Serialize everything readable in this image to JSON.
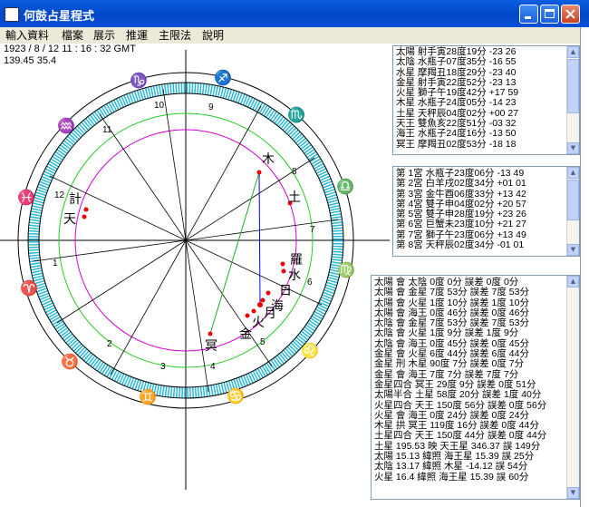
{
  "window": {
    "title": "何鼓占星程式"
  },
  "menu": [
    "輸入資料",
    "檔案",
    "展示",
    "推運",
    "主限法",
    "說明"
  ],
  "info": {
    "datetime": "1923 / 8 / 12    11 : 16 : 32 GMT",
    "coords": "139.45   35.4"
  },
  "chart": {
    "signs": [
      "♑",
      "♒",
      "♓",
      "♈",
      "♉",
      "♊",
      "♋",
      "♌",
      "♍",
      "♎",
      "♏",
      "♐"
    ],
    "houses": [
      "1",
      "2",
      "3",
      "4",
      "5",
      "6",
      "7",
      "8",
      "9",
      "10",
      "11",
      "12"
    ],
    "planets": {
      "moon": "月",
      "sun": "日",
      "mercury": "水",
      "venus": "金",
      "mars": "火",
      "jupiter": "木",
      "saturn": "土",
      "uranus": "天",
      "neptune": "海",
      "pluto": "冥",
      "node": "羅",
      "south_node": "計"
    }
  },
  "planet_panel": [
    "太陽  射手寅28度19分   -23 26",
    "太陰  水瓶子07度35分   -16 55",
    "水星  摩羯丑18度29分   -23 40",
    "金星  射手寅22度52分   -23 13",
    "火星  獅子午19度42分   +17 59",
    "木星  水瓶子24度05分   -14 23",
    "土星  天秤辰04度02分   +00 27",
    "天王  雙魚亥22度51分   -03 32",
    "海王  水瓶子24度16分   -13 50",
    "冥王  摩羯丑02度53分   -18 18"
  ],
  "house_panel": [
    "第 1宮  水瓶子23度06分  -13 49",
    "第 2宮  白羊戌02度34分  +01 01",
    "第 3宮  金牛酉06度33分  +13 42",
    "第 4宮  雙子申04度02分  +20 57",
    "第 5宮  雙子申28度19分  +23 26",
    "第 6宮  巨蟹未23度10分  +21 27",
    "第 7宮  獅子午23度06分  +13 49",
    "第 8宮  天秤辰02度34分  -01 01"
  ],
  "aspects_panel": [
    "太陽 會 太陰 0度 0分  誤差 0度 0分",
    "太陽 會 金星 7度 53分  誤差 7度 53分",
    "太陽 會 火星 1度 10分  誤差 1度 10分",
    "太陽 會 海王 0度 46分  誤差 0度 46分",
    "太陰 會 金星 7度 53分  誤差 7度 53分",
    "太陰 會 火星 1度 9分  誤差 1度 9分",
    "太陰 會 海王 0度 45分  誤差 0度 45分",
    "金星 會 火星 6度 44分  誤差 6度 44分",
    "金星 刑 木星 90度 7分  誤差 0度 7分",
    "金星 會 海王 7度 7分  誤差 7度 7分",
    "金星四合 冥王 29度 9分  誤差 0度 51分",
    "太陽半合 土星 58度 20分  誤差 1度 40分",
    "火星四合 天王 150度 56分  誤差 0度 56分",
    "火星 會 海王 0度 24分  誤差 0度 24分",
    "木星 拱 冥王 119度 16分  誤差 0度 44分",
    "土星四合 天王 150度 44分  誤差 0度 44分",
    "土星 195.53 映  天王星 346.37 誤   149分",
    "太陽 15.13 緯照  海王星 15.39 誤    25分",
    "太陰 13.17 緯照  木星 -14.12 誤    54分",
    "火星 16.4 緯照  海王星 15.39 誤    60分"
  ]
}
